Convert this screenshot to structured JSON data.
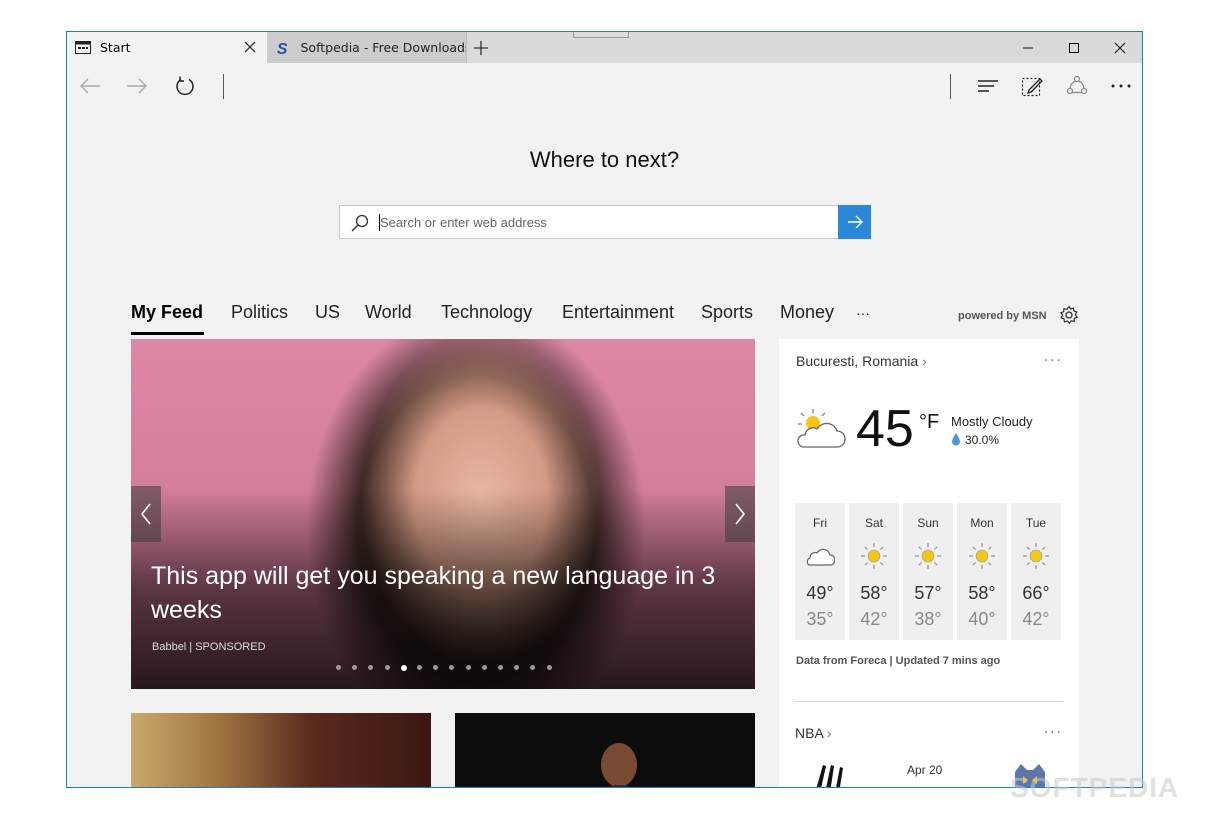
{
  "tabs": [
    {
      "title": "Start",
      "icon": "start-page-icon",
      "active": true
    },
    {
      "title": "Softpedia - Free Downloads",
      "icon": "softpedia-logo-icon",
      "active": false
    }
  ],
  "toolbar_icons": [
    "back-arrow-icon",
    "forward-arrow-icon",
    "refresh-icon",
    "hub-icon",
    "web-note-icon",
    "share-icon",
    "more-icon"
  ],
  "search": {
    "heading": "Where to next?",
    "placeholder": "Search or enter web address"
  },
  "feed_tabs": [
    {
      "label": "My Feed",
      "active": true
    },
    {
      "label": "Politics"
    },
    {
      "label": "US"
    },
    {
      "label": "World"
    },
    {
      "label": "Technology"
    },
    {
      "label": "Entertainment"
    },
    {
      "label": "Sports"
    },
    {
      "label": "Money"
    },
    {
      "label": "···"
    }
  ],
  "powered_by": "powered by MSN",
  "hero": {
    "title": "This app will get you speaking a new language in 3 weeks",
    "source": "Babbel | SPONSORED",
    "slide_count": 14,
    "active_slide": 5
  },
  "weather": {
    "location": "Bucuresti, Romania",
    "location_chevron": "›",
    "more": "···",
    "temp": "45",
    "unit": "°F",
    "condition": "Mostly Cloudy",
    "precip": "30.0%",
    "forecast": [
      {
        "day": "Fri",
        "icon": "cloudy-icon",
        "hi": "49°",
        "lo": "35°"
      },
      {
        "day": "Sat",
        "icon": "sunny-icon",
        "hi": "58°",
        "lo": "42°"
      },
      {
        "day": "Sun",
        "icon": "sunny-icon",
        "hi": "57°",
        "lo": "38°"
      },
      {
        "day": "Mon",
        "icon": "sunny-icon",
        "hi": "58°",
        "lo": "40°"
      },
      {
        "day": "Tue",
        "icon": "sunny-icon",
        "hi": "66°",
        "lo": "42°"
      }
    ],
    "source": "Data from Foreca | Updated 7 mins ago"
  },
  "nba": {
    "title": "NBA",
    "chevron": "›",
    "more": "···",
    "date": "Apr 20"
  },
  "watermark": "SOFTPEDIA",
  "colors": {
    "accent": "#2b88d8",
    "window_border": "#1b7fc4",
    "sun": "#f5c518"
  }
}
